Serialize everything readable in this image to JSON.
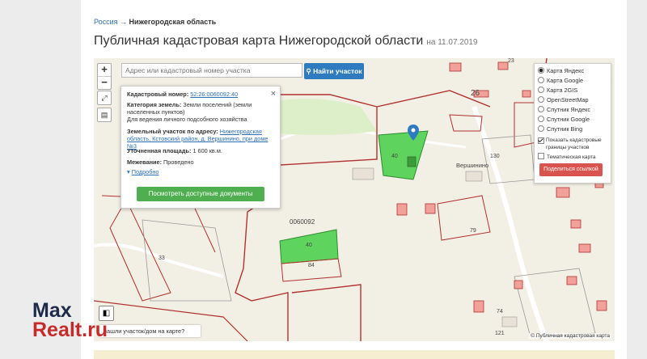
{
  "breadcrumb": {
    "root": "Россия",
    "separator": "→",
    "current": "Нижегородская область"
  },
  "page": {
    "title": "Публичная кадастровая карта Нижегородской области",
    "date": "на 11.07.2019"
  },
  "search": {
    "placeholder": "Адрес или кадастровый номер участка",
    "button": "Найти участок"
  },
  "zoom": {
    "plus": "+",
    "minus": "−"
  },
  "popup": {
    "cad_label": "Кадастровый номер:",
    "cad_value": "52:26:0060092:40",
    "cat_label": "Категория земель:",
    "cat_value": "Земли поселений (земли населенных пунктов)",
    "use_value": "Для ведения личного подсобного хозяйства",
    "addr_label": "Земельный участок по адресу:",
    "addr_value": "Нижегородская область, Кстовский район, д. Вершинино, при доме №3",
    "area_label": "Уточненная площадь:",
    "area_value": "1 600 кв.м.",
    "survey_label": "Межевание:",
    "survey_value": "Проведено",
    "more": "Подробно",
    "docs_button": "Посмотреть доступные документы",
    "close": "×"
  },
  "layers": {
    "options": [
      "Карта Яндекс",
      "Карта Google",
      "Карта 2GIS",
      "OpenStreetMap",
      "Спутник Яндекс",
      "Спутник Google",
      "Спутник Bing"
    ],
    "selected": 0,
    "checkbox_cadastral": "Показать кадастровые границы участков",
    "checkbox_thematic": "Тематическая карта",
    "share_button": "Поделиться ссылкой"
  },
  "map_labels": {
    "quarter": "0060092",
    "house_26": "26",
    "village": "Вершинино",
    "plot_40_top": "40",
    "plot_40": "40",
    "plot_84": "84",
    "n33": "33",
    "n79": "79",
    "n130": "130",
    "n23": "23",
    "n74": "74",
    "n121": "121"
  },
  "found_prompt": "нашли участок/дом на карте?",
  "copyright": "© Публичная кадастровая карта",
  "watermark": {
    "line1": "Max",
    "line2": "Realt.ru"
  },
  "colors": {
    "accent": "#2f7bbf",
    "green_plot": "#5ed35e",
    "share": "#d9534f",
    "docs": "#4fae4f",
    "boundary": "#b2322f"
  }
}
